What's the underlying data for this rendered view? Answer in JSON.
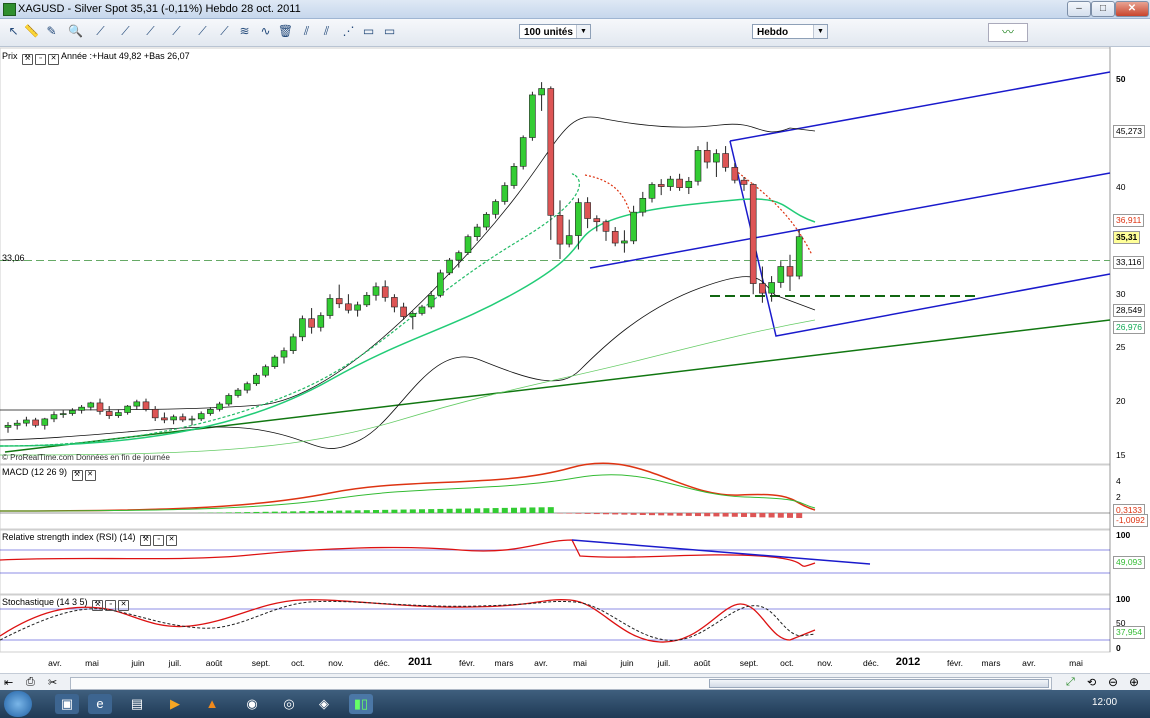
{
  "window": {
    "title": "XAGUSD - Silver Spot    35,31 (-0,11%)     Hebdo   28 oct. 2011"
  },
  "toolbar": {
    "units": "100 unités",
    "period": "Hebdo"
  },
  "price_panel": {
    "label": "Prix",
    "info": "Année :+Haut 49,82 +Bas 26,07",
    "watermark": "© ProRealTime.com  Données en fin de journée",
    "level_label": "33,06",
    "axis_ticks": [
      "50",
      "45",
      "40",
      "35",
      "30",
      "25",
      "20",
      "15"
    ],
    "price_labels": {
      "p1": "45,273",
      "p2": "36,911",
      "p3": "35,31",
      "p4": "33,116",
      "p5": "28,549",
      "p6": "26,976"
    }
  },
  "macd_panel": {
    "label": "MACD (12 26 9)",
    "axis_ticks": [
      "4",
      "2",
      "0"
    ],
    "labels": {
      "a": "0,3133",
      "b": "-1,0092"
    }
  },
  "rsi_panel": {
    "label": "Relative strength index (RSI) (14)",
    "axis_ticks": [
      "100",
      "0"
    ],
    "labels": {
      "a": "49,093"
    }
  },
  "stoch_panel": {
    "label": "Stochastique (14 3 5)",
    "axis_ticks": [
      "100",
      "50",
      "0"
    ],
    "labels": {
      "a": "37,954"
    }
  },
  "months": [
    "avr.",
    "mai",
    "juin",
    "juil.",
    "août",
    "sept.",
    "oct.",
    "nov.",
    "déc.",
    "2011",
    "févr.",
    "mars",
    "avr.",
    "mai",
    "juin",
    "juil.",
    "août",
    "sept.",
    "oct.",
    "nov.",
    "déc.",
    "2012",
    "févr.",
    "mars",
    "avr.",
    "mai"
  ],
  "taskbar": {
    "clock": "12:00"
  },
  "colors": {
    "up": "#33cc33",
    "down": "#dd5555",
    "channel": "#1a1acc",
    "trend": "#117711",
    "ma_fast": "#22cc77",
    "ma_slow": "#66cc66",
    "macd": "#dd3311",
    "signal": "#33bb33"
  },
  "chart_data": {
    "type": "candlestick",
    "timeframe": "weekly",
    "ylim": [
      15,
      51.5
    ],
    "candles": [
      [
        17.4,
        17.9,
        16.9,
        17.6
      ],
      [
        17.6,
        18.1,
        17.2,
        17.8
      ],
      [
        17.8,
        18.4,
        17.5,
        18.1
      ],
      [
        18.1,
        18.3,
        17.4,
        17.6
      ],
      [
        17.6,
        18.3,
        17.2,
        18.2
      ],
      [
        18.2,
        18.9,
        17.9,
        18.6
      ],
      [
        18.6,
        19.0,
        18.3,
        18.7
      ],
      [
        18.7,
        19.2,
        18.5,
        19.0
      ],
      [
        19.0,
        19.5,
        18.7,
        19.3
      ],
      [
        19.3,
        19.8,
        19.0,
        19.7
      ],
      [
        19.7,
        20.1,
        18.6,
        18.9
      ],
      [
        18.9,
        19.4,
        18.2,
        18.5
      ],
      [
        18.5,
        19.1,
        18.3,
        18.8
      ],
      [
        18.8,
        19.5,
        18.6,
        19.4
      ],
      [
        19.4,
        20.0,
        19.1,
        19.8
      ],
      [
        19.8,
        20.1,
        18.9,
        19.1
      ],
      [
        19.1,
        19.4,
        18.0,
        18.3
      ],
      [
        18.3,
        18.8,
        17.8,
        18.1
      ],
      [
        18.1,
        18.6,
        17.7,
        18.4
      ],
      [
        18.4,
        18.7,
        17.9,
        18.1
      ],
      [
        18.1,
        18.5,
        17.6,
        18.2
      ],
      [
        18.2,
        18.9,
        18.0,
        18.7
      ],
      [
        18.7,
        19.3,
        18.5,
        19.1
      ],
      [
        19.1,
        19.8,
        18.9,
        19.6
      ],
      [
        19.6,
        20.6,
        19.4,
        20.4
      ],
      [
        20.4,
        21.1,
        20.2,
        20.9
      ],
      [
        20.9,
        21.7,
        20.6,
        21.5
      ],
      [
        21.5,
        22.5,
        21.3,
        22.3
      ],
      [
        22.3,
        23.3,
        22.1,
        23.1
      ],
      [
        23.1,
        24.2,
        22.9,
        24.0
      ],
      [
        24.0,
        24.9,
        23.4,
        24.6
      ],
      [
        24.6,
        26.2,
        24.3,
        25.9
      ],
      [
        25.9,
        27.9,
        25.5,
        27.6
      ],
      [
        27.6,
        28.6,
        26.2,
        26.8
      ],
      [
        26.8,
        28.2,
        26.4,
        27.9
      ],
      [
        27.9,
        29.9,
        27.6,
        29.5
      ],
      [
        29.5,
        30.8,
        28.6,
        29.0
      ],
      [
        29.0,
        29.9,
        28.1,
        28.4
      ],
      [
        28.4,
        29.2,
        27.8,
        28.9
      ],
      [
        28.9,
        30.1,
        28.7,
        29.8
      ],
      [
        29.8,
        31.0,
        29.3,
        30.6
      ],
      [
        30.6,
        31.2,
        29.2,
        29.6
      ],
      [
        29.6,
        29.9,
        28.2,
        28.7
      ],
      [
        28.7,
        29.1,
        27.5,
        27.8
      ],
      [
        27.8,
        28.3,
        26.6,
        28.1
      ],
      [
        28.1,
        28.9,
        27.9,
        28.7
      ],
      [
        28.7,
        30.2,
        28.5,
        29.8
      ],
      [
        29.8,
        32.2,
        29.6,
        31.9
      ],
      [
        31.9,
        33.3,
        31.7,
        33.1
      ],
      [
        33.1,
        34.0,
        32.4,
        33.8
      ],
      [
        33.8,
        35.5,
        33.6,
        35.3
      ],
      [
        35.3,
        36.5,
        34.9,
        36.2
      ],
      [
        36.2,
        37.6,
        35.9,
        37.4
      ],
      [
        37.4,
        38.8,
        37.0,
        38.6
      ],
      [
        38.6,
        40.4,
        38.3,
        40.1
      ],
      [
        40.1,
        42.2,
        39.8,
        41.9
      ],
      [
        41.9,
        44.8,
        41.6,
        44.6
      ],
      [
        44.6,
        48.9,
        44.3,
        48.6
      ],
      [
        48.6,
        49.8,
        47.1,
        49.2
      ],
      [
        49.2,
        49.4,
        35.0,
        37.3
      ],
      [
        37.3,
        38.7,
        33.2,
        34.6
      ],
      [
        34.6,
        36.9,
        34.3,
        35.4
      ],
      [
        35.4,
        38.9,
        34.1,
        38.5
      ],
      [
        38.5,
        39.0,
        36.1,
        37.0
      ],
      [
        37.0,
        37.3,
        35.8,
        36.7
      ],
      [
        36.7,
        36.9,
        34.9,
        35.8
      ],
      [
        35.8,
        36.2,
        34.4,
        34.7
      ],
      [
        34.7,
        35.9,
        33.8,
        34.9
      ],
      [
        34.9,
        38.2,
        34.6,
        37.6
      ],
      [
        37.6,
        39.5,
        37.2,
        38.9
      ],
      [
        38.9,
        40.4,
        38.5,
        40.2
      ],
      [
        40.2,
        40.7,
        39.2,
        40.0
      ],
      [
        40.0,
        41.0,
        39.6,
        40.7
      ],
      [
        40.7,
        41.2,
        39.6,
        39.9
      ],
      [
        39.9,
        40.9,
        39.3,
        40.5
      ],
      [
        40.5,
        43.8,
        40.1,
        43.4
      ],
      [
        43.4,
        44.2,
        41.7,
        42.3
      ],
      [
        42.3,
        43.5,
        40.9,
        43.1
      ],
      [
        43.1,
        43.8,
        41.4,
        41.8
      ],
      [
        41.8,
        42.2,
        40.3,
        40.6
      ],
      [
        40.6,
        40.9,
        39.6,
        40.2
      ],
      [
        40.2,
        40.3,
        29.9,
        30.9
      ],
      [
        30.9,
        32.5,
        29.1,
        30.0
      ],
      [
        30.0,
        31.6,
        29.2,
        31.0
      ],
      [
        31.0,
        33.0,
        30.5,
        32.5
      ],
      [
        32.5,
        33.6,
        30.2,
        31.6
      ],
      [
        31.6,
        36.0,
        31.3,
        35.3
      ]
    ]
  }
}
